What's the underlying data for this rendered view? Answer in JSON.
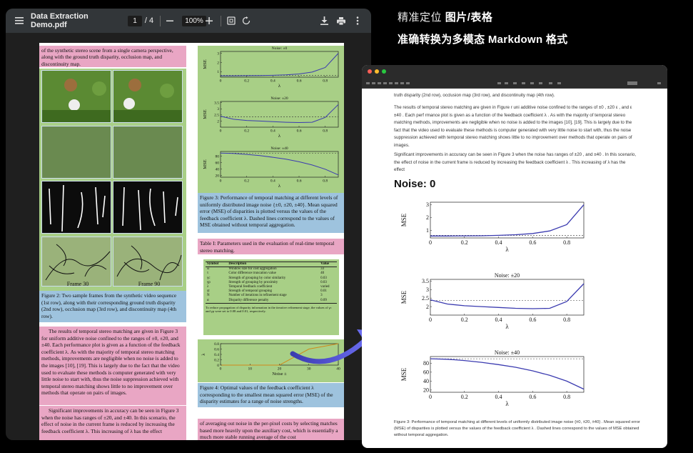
{
  "viewer": {
    "filename": "Data Extraction Demo.pdf",
    "current_page": "1",
    "total_pages": "/ 4",
    "zoom": "100%",
    "icons": [
      "menu-icon",
      "zoom-out-icon",
      "zoom-in-icon",
      "fit-page-icon",
      "rotate-icon",
      "download-icon",
      "print-icon",
      "more-icon"
    ]
  },
  "pdf": {
    "block_top_left": "of the synthetic stereo scene from a single camera perspective, along with the ground truth disparity, occlusion map, and discontinuity map.",
    "frame_labels": [
      "Frame 30",
      "Frame 90"
    ],
    "fig2_caption": "Figure 2: Two sample frames from the synthetic video sequence (1st row), along with their corresponding ground truth disparity (2nd row), occlusion map (3rd row), and discontinuity map (4th row).",
    "body_para1": "The results of temporal stereo matching are given in Figure 3 for uniform additive noise confined to the ranges of ±0, ±20, and ±40. Each performance plot is given as a function of the feedback coefficient λ. As with the majority of temporal stereo matching methods, improvements are negligible when no noise is added to the images [10], [19]. This is largely due to the fact that the video used to evaluate these methods is computer generated with very little noise to start with, thus the noise suppression achieved with temporal stereo matching shows little to no improvement over methods that operate on pairs of images.",
    "body_para2": "Significant improvements in accuracy can be seen in Figure 3 when the noise has ranges of ±20, and ±40. In this scenario, the effect of noise in the current frame is reduced by increasing the feedback coefficient λ. This increasing of λ has the effect",
    "plot_titles": [
      "Noise: ±0",
      "Noise: ±20",
      "Noise: ±40"
    ],
    "fig3_caption": "Figure 3: Performance of temporal matching at different levels of uniformly distributed image noise {±0, ±20, ±40}. Mean squared error (MSE) of disparities is plotted versus the values of the feedback coefficient λ. Dashed lines correspond to the values of MSE obtained without temporal aggregation.",
    "table1_caption": "Table I: Parameters used in the evaluation of real-time temporal stereo matching.",
    "table1": {
      "headers": [
        "Symbol",
        "Description",
        "Value"
      ],
      "rows": [
        [
          "ω",
          "Window size for cost aggregation",
          "33"
        ],
        [
          "τ",
          "Color difference truncation value",
          "40"
        ],
        [
          "γc",
          "Strength of grouping by color similarity",
          "0.03"
        ],
        [
          "γp",
          "Strength of grouping by proximity",
          "0.03"
        ],
        [
          "λ",
          "Temporal feedback coefficient",
          "varied"
        ],
        [
          "γt",
          "Strength of temporal grouping",
          "0.01"
        ],
        [
          "N",
          "Number of iterations in refinement stage",
          "3"
        ],
        [
          "α",
          "Disparity difference penalty",
          "0.09"
        ]
      ],
      "footnote": "To reduce propagation of disparity information in the iterative refinement stage, the values of γc and γp were set to 0.08 and 0.01, respectively."
    },
    "fig4_caption": "Figure 4: Optimal values of the feedback coefficient λ corresponding to the smallest mean squared error (MSE) of the disparity estimates for a range of noise strengths.",
    "fig4_xlabel": "Noise ±",
    "fig4_ylabel": "λ",
    "bottom_right_text": "of averaging out noise in the per-pixel costs by selecting matches based more heavily upon the auxiliary cost, which is essentially a much more stable running average of the cost"
  },
  "headline": {
    "line1_part1": "精准定位",
    "line1_part2": "图片/表格",
    "line2": "准确转换为多模态 Markdown 格式"
  },
  "markdown": {
    "top_line": "truth disparity (2nd row), occlusion map (3rd row), and discontinuity map (4th row).",
    "para1": "The results of temporal stereo matching are given in Figure r uni additive noise confined to the ranges of ±0 , ±20 ε , and ε ±40 . Each perf rmance plot is given as a function of the feedback coefficient λ . As with the majority of temporal stereo matching methods, improvements are negligible when no noise is added to the images [10], [19]. This is largely due to the fact that the video used to evaluate these methods is computer generated with very little noise to start with, thus the noise suppression achieved with temporal stereo matching shows little to no improvement over methods that operate on pairs of images.",
    "para2": "Significant improvements in accuracy can be seen in Figure 3 when the noise has ranges of ±20 , and ±40 . In this scenario, the effect of noise in the current frame is reduced by increasing the feedback coefficient λ . This increasing of λ has the effect",
    "heading": "Noise: 0",
    "plot_titles": [
      "",
      "Noise: ±20",
      "Noise: ±40"
    ],
    "caption": "Figure 3: Performance of temporal matching at different levels of uniformly distributed image noise {±0, ±20, ±40} . Mean squared error (MSE) of disparities is plotted versus the values of the feedback coefficient λ . Dashed lines correspond to the values of MSE obtained without temporal aggregation."
  },
  "chart_data": [
    {
      "type": "line",
      "title": "",
      "xlabel": "λ",
      "ylabel": "MSE",
      "x": [
        0,
        0.1,
        0.2,
        0.3,
        0.4,
        0.5,
        0.6,
        0.7,
        0.8,
        0.9
      ],
      "series": [
        {
          "values": [
            0.55,
            0.55,
            0.56,
            0.57,
            0.6,
            0.65,
            0.75,
            0.95,
            1.45,
            3.0
          ]
        }
      ],
      "baseline": 0.6,
      "xlim": [
        0,
        0.9
      ],
      "ylim": [
        0.4,
        3.2
      ],
      "xticks": [
        "0",
        "0.2",
        "0.4",
        "0.6",
        "0.8"
      ],
      "yticks": [
        "1",
        "2",
        "3"
      ]
    },
    {
      "type": "line",
      "title": "Noise: ±20",
      "xlabel": "λ",
      "ylabel": "MSE",
      "x": [
        0,
        0.1,
        0.2,
        0.3,
        0.4,
        0.5,
        0.6,
        0.7,
        0.8,
        0.9
      ],
      "series": [
        {
          "values": [
            2.4,
            2.15,
            2.05,
            2.0,
            1.95,
            1.9,
            1.88,
            1.9,
            2.3,
            3.35
          ]
        }
      ],
      "baseline": 2.35,
      "xlim": [
        0,
        0.9
      ],
      "ylim": [
        1.5,
        3.6
      ],
      "xticks": [
        "0",
        "0.2",
        "0.4",
        "0.6",
        "0.8"
      ],
      "yticks": [
        "2",
        "2.5",
        "3",
        "3.5"
      ]
    },
    {
      "type": "line",
      "title": "Noise: ±40",
      "xlabel": "λ",
      "ylabel": "MSE",
      "x": [
        0,
        0.1,
        0.2,
        0.3,
        0.4,
        0.5,
        0.6,
        0.7,
        0.8,
        0.9
      ],
      "series": [
        {
          "values": [
            90,
            89,
            86,
            82,
            77,
            71,
            63,
            53,
            40,
            22
          ]
        }
      ],
      "baseline": 90,
      "xlim": [
        0,
        0.9
      ],
      "ylim": [
        15,
        95
      ],
      "xticks": [
        "0",
        "0.2",
        "0.4",
        "0.6",
        "0.8"
      ],
      "yticks": [
        "20",
        "40",
        "60",
        "80"
      ]
    },
    {
      "type": "line",
      "title": "",
      "xlabel": "Noise ±",
      "ylabel": "λ",
      "x": [
        0,
        10,
        20,
        30,
        40
      ],
      "series": [
        {
          "values": [
            0.0,
            0.0,
            0.0,
            0.6,
            0.8
          ]
        }
      ],
      "xlim": [
        0,
        40
      ],
      "ylim": [
        0,
        0.8
      ],
      "xticks": [
        "0",
        "10",
        "20",
        "30",
        "40"
      ],
      "yticks": [
        "0",
        "0.2",
        "0.4",
        "0.6",
        "0.8"
      ]
    }
  ],
  "colors": {
    "accent": "#5b5bd6",
    "pink": "#e9a6c4",
    "green": "#a8cf86",
    "blue": "#9ec3de",
    "toolbar": "#323639"
  }
}
